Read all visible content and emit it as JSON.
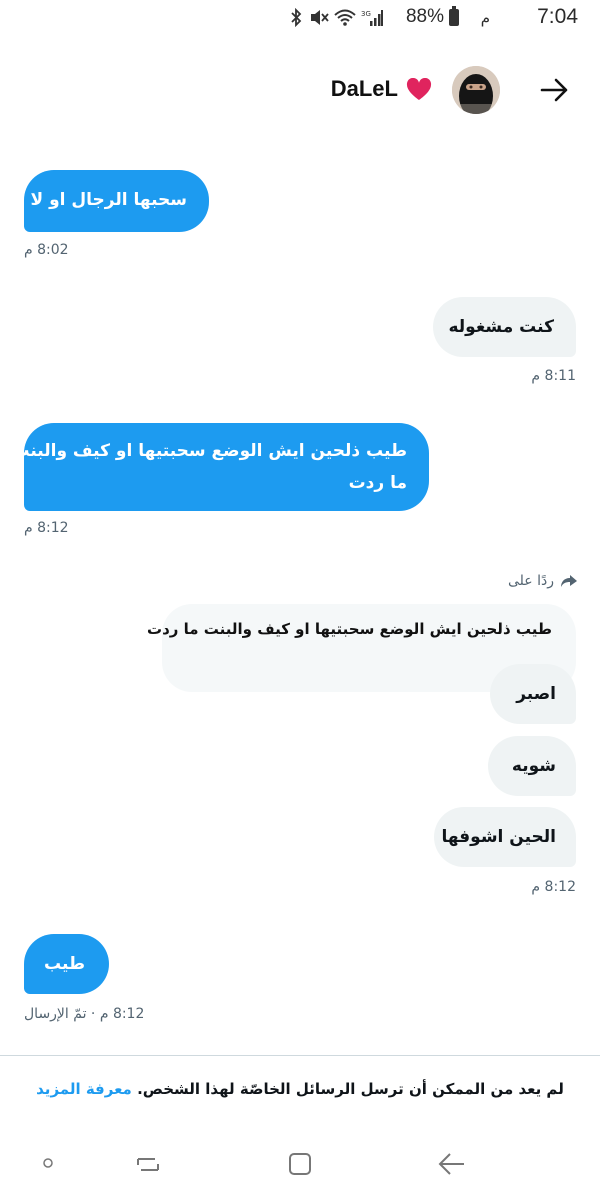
{
  "status_bar": {
    "time": "7:04",
    "ampm": "م",
    "battery": "88%",
    "icons": [
      "bluetooth-icon",
      "mute-icon",
      "wifi-icon",
      "signal-3g-icon",
      "battery-icon"
    ]
  },
  "header": {
    "contact_name": "DaLeL",
    "name_emoji": "heart-icon",
    "back_icon": "arrow-right-icon"
  },
  "messages": [
    {
      "text": "سحبها الرجال او لا",
      "type": "sent",
      "time": "8:02 م"
    },
    {
      "text": "كنت مشغوله",
      "type": "received",
      "time": "8:11 م"
    },
    {
      "text_lines": [
        "طيب ذلحين ايش الوضع سحبتيها او كيف والبنت",
        "ما ردت"
      ],
      "type": "sent",
      "time": "8:12 م"
    },
    {
      "reply_label": "ردًا على",
      "quoted_text": "طيب ذلحين ايش الوضع سحبتيها او كيف والبنت ما ردت",
      "bubbles": [
        "اصبر",
        "شويه",
        "الحين اشوفها"
      ],
      "type": "received",
      "time": "8:12 م"
    },
    {
      "text": "طيب",
      "type": "sent",
      "time": "8:12 م · تمّ الإرسال"
    }
  ],
  "footer": {
    "notice": "لم يعد من الممكن أن ترسل الرسائل الخاصّة لهذا الشخص.",
    "learn_more": "معرفة المزيد"
  },
  "colors": {
    "sent_bubble": "#1d9bf0",
    "received_bubble": "#eff3f4",
    "link": "#1d9bf0",
    "heart": "#e0245e"
  }
}
